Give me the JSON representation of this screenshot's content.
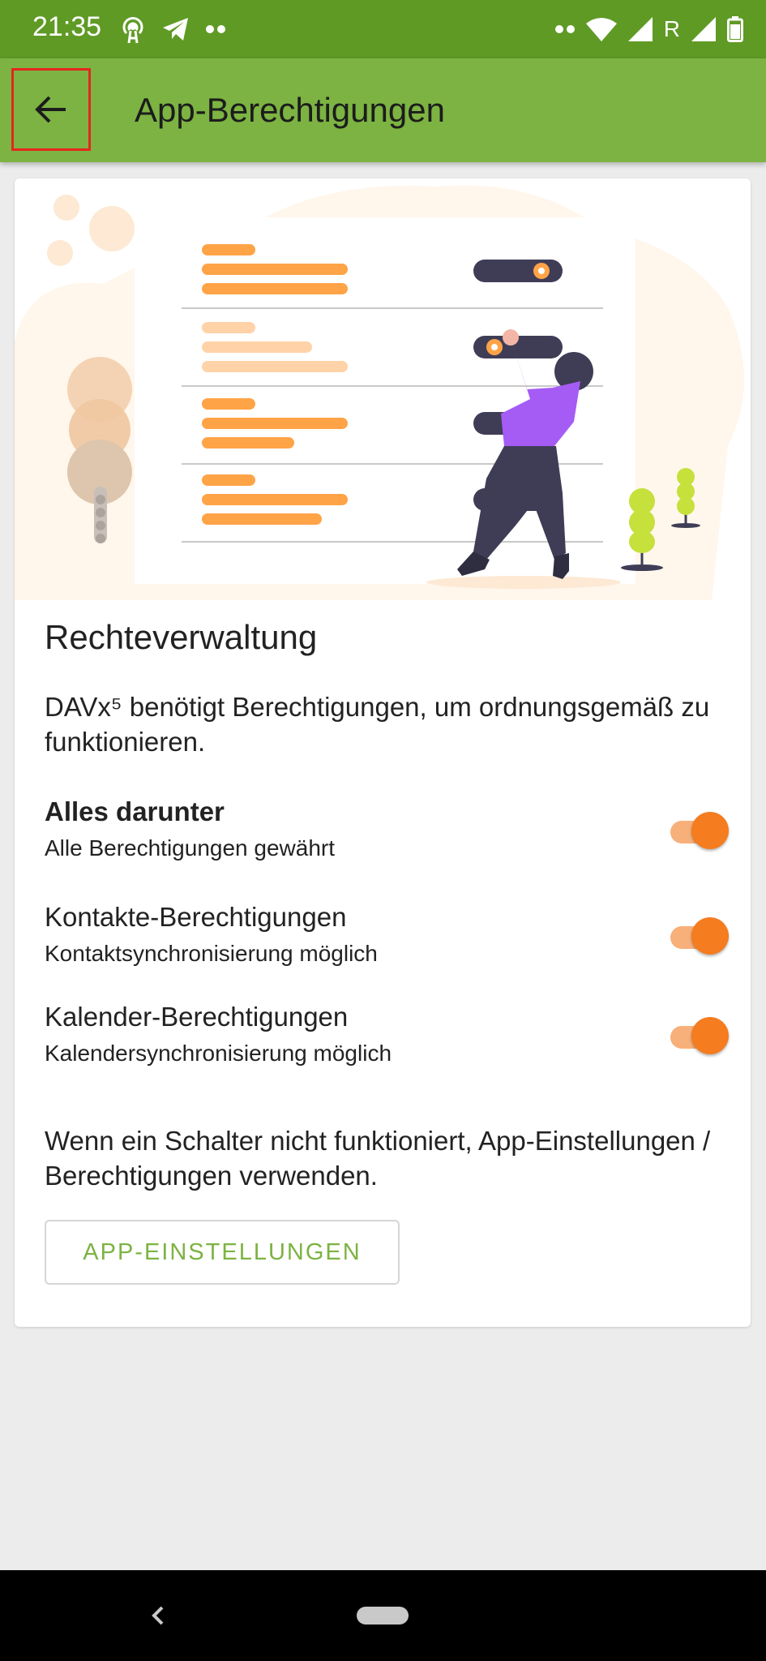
{
  "status_bar": {
    "time": "21:35",
    "left_icons": [
      "hotspot-icon",
      "telegram-icon",
      "more-dots-icon"
    ],
    "right_icons": [
      "more-dots-icon",
      "wifi-icon",
      "signal-icon",
      "roaming-indicator",
      "signal-icon",
      "battery-icon"
    ],
    "roaming_label": "R"
  },
  "app_bar": {
    "title": "App-Berechtigungen",
    "back_icon": "arrow-back-icon",
    "color": "#7cb342"
  },
  "card": {
    "heading": "Rechteverwaltung",
    "intro": "DAVx⁵ benötigt Berechtigungen, um ordnungsgemäß zu funktionieren.",
    "permissions": [
      {
        "title": "Alles darunter",
        "subtitle": "Alle Berechtigungen gewährt",
        "enabled": true
      },
      {
        "title": "Kontakte-Berechtigungen",
        "subtitle": "Kontaktsynchronisierung möglich",
        "enabled": true
      },
      {
        "title": "Kalender-Berechtigungen",
        "subtitle": "Kalendersynchronisierung möglich",
        "enabled": true
      }
    ],
    "hint": "Wenn ein Schalter nicht funktioniert, App-Einstellungen / Berechtigungen verwenden.",
    "button_label": "APP-EINSTELLUNGEN"
  },
  "colors": {
    "accent": "#f57c1f",
    "primary": "#7cb342",
    "primary_dark": "#5f9a25"
  },
  "nav_bar": {
    "icons": [
      "nav-back-icon",
      "nav-home-pill"
    ]
  }
}
